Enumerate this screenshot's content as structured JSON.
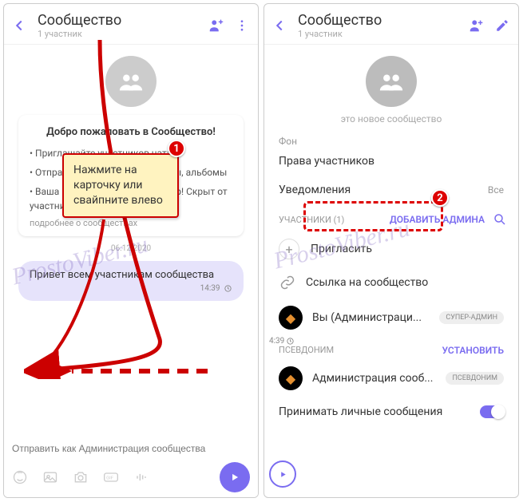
{
  "left": {
    "header": {
      "title": "Сообщество",
      "subtitle": "1 участник"
    },
    "welcome": {
      "title": "Добро пожаловать в Сообщество!",
      "bullets": [
        "Приглашайте участников чата",
        "Отправляйте сообщения, файлы, альбомы",
        "Ваша приватность — ваш выбор! Скрыт от участников"
      ],
      "more": "подробнее о сообществах"
    },
    "date": "06.12.2020",
    "message": {
      "text": "Привет всем участникам сообщества",
      "time": "14:39"
    },
    "composer_placeholder": "Отправить как Администрация сообщества"
  },
  "right": {
    "header": {
      "title": "Сообщество",
      "subtitle": "1 участник"
    },
    "intro": "это новое сообщество",
    "section_bg": "Фон",
    "item_rights": "Права участников",
    "item_notifications": {
      "label": "Уведомления",
      "value": "Все"
    },
    "participants": {
      "label": "УЧАСТНИКИ (1)",
      "add_admin": "ДОБАВИТЬ АДМИНА"
    },
    "invite": "Пригласить",
    "link": "Ссылка на сообщество",
    "you": {
      "name": "Вы (Администраци...",
      "badge": "СУПЕР-АДМИН"
    },
    "pseudonym": {
      "label": "ПСЕВДОНИМ",
      "action": "УСТАНОВИТЬ",
      "name": "Администрация сооб...",
      "badge": "ПСЕВДОНИМ"
    },
    "accept_dm": "Принимать личные сообщения",
    "time_frag": "4:39"
  },
  "annot": {
    "callout": "Нажмите на карточку или свайпните влево",
    "badge1": "1",
    "badge2": "2",
    "watermark": "ProstoViber.ru"
  }
}
